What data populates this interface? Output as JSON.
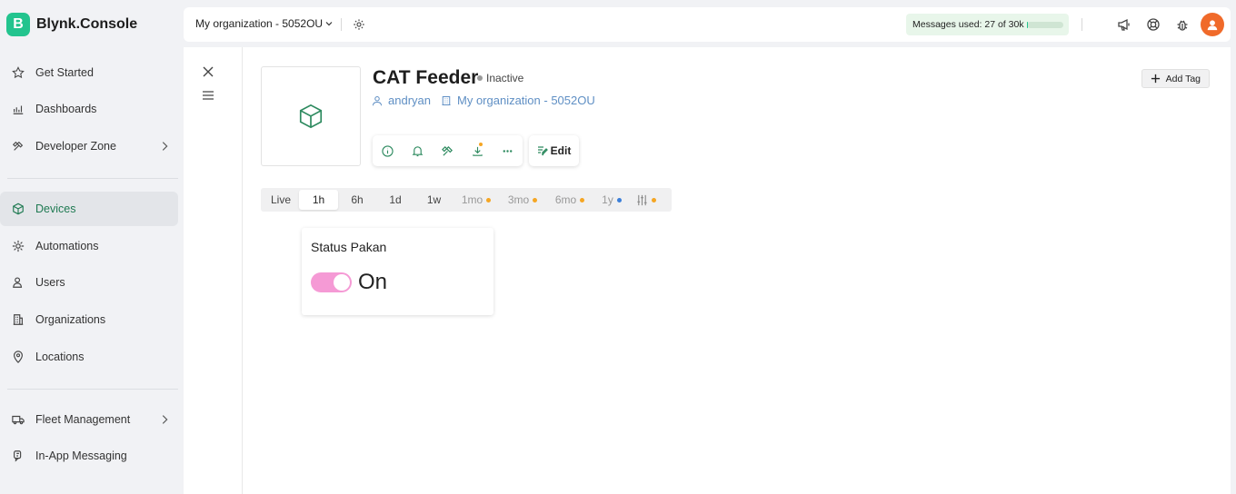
{
  "brand": {
    "letter": "B",
    "name": "Blynk.Console"
  },
  "sidebar": {
    "items": [
      {
        "label": "Get Started",
        "icon": "star-icon"
      },
      {
        "label": "Dashboards",
        "icon": "chart-icon"
      },
      {
        "label": "Developer Zone",
        "icon": "tools-icon"
      },
      {
        "label": "Devices",
        "icon": "cube-icon",
        "active": true
      },
      {
        "label": "Automations",
        "icon": "automation-icon"
      },
      {
        "label": "Users",
        "icon": "users-icon"
      },
      {
        "label": "Organizations",
        "icon": "building-icon"
      },
      {
        "label": "Locations",
        "icon": "pin-icon"
      },
      {
        "label": "Fleet Management",
        "icon": "truck-icon"
      },
      {
        "label": "In-App Messaging",
        "icon": "message-icon"
      }
    ]
  },
  "topbar": {
    "org": "My organization - 5052OU",
    "messages": "Messages used: 27 of 30k",
    "messages_fraction": 0.001
  },
  "device": {
    "name": "CAT Feeder",
    "status": "Inactive",
    "owner": "andryan",
    "org": "My organization - 5052OU",
    "edit": "Edit",
    "add_tag": "Add Tag"
  },
  "periods": [
    "Live",
    "1h",
    "6h",
    "1d",
    "1w",
    "1mo",
    "3mo",
    "6mo",
    "1y"
  ],
  "selected_period": "1h",
  "widget": {
    "title": "Status Pakan",
    "value": "On",
    "state": true
  },
  "colors": {
    "accent": "#23c48e",
    "switch_on": "#f59ad5",
    "link": "#5f8fc4",
    "orange_dot": "#f5a623",
    "blue_dot": "#3b7fd9"
  }
}
